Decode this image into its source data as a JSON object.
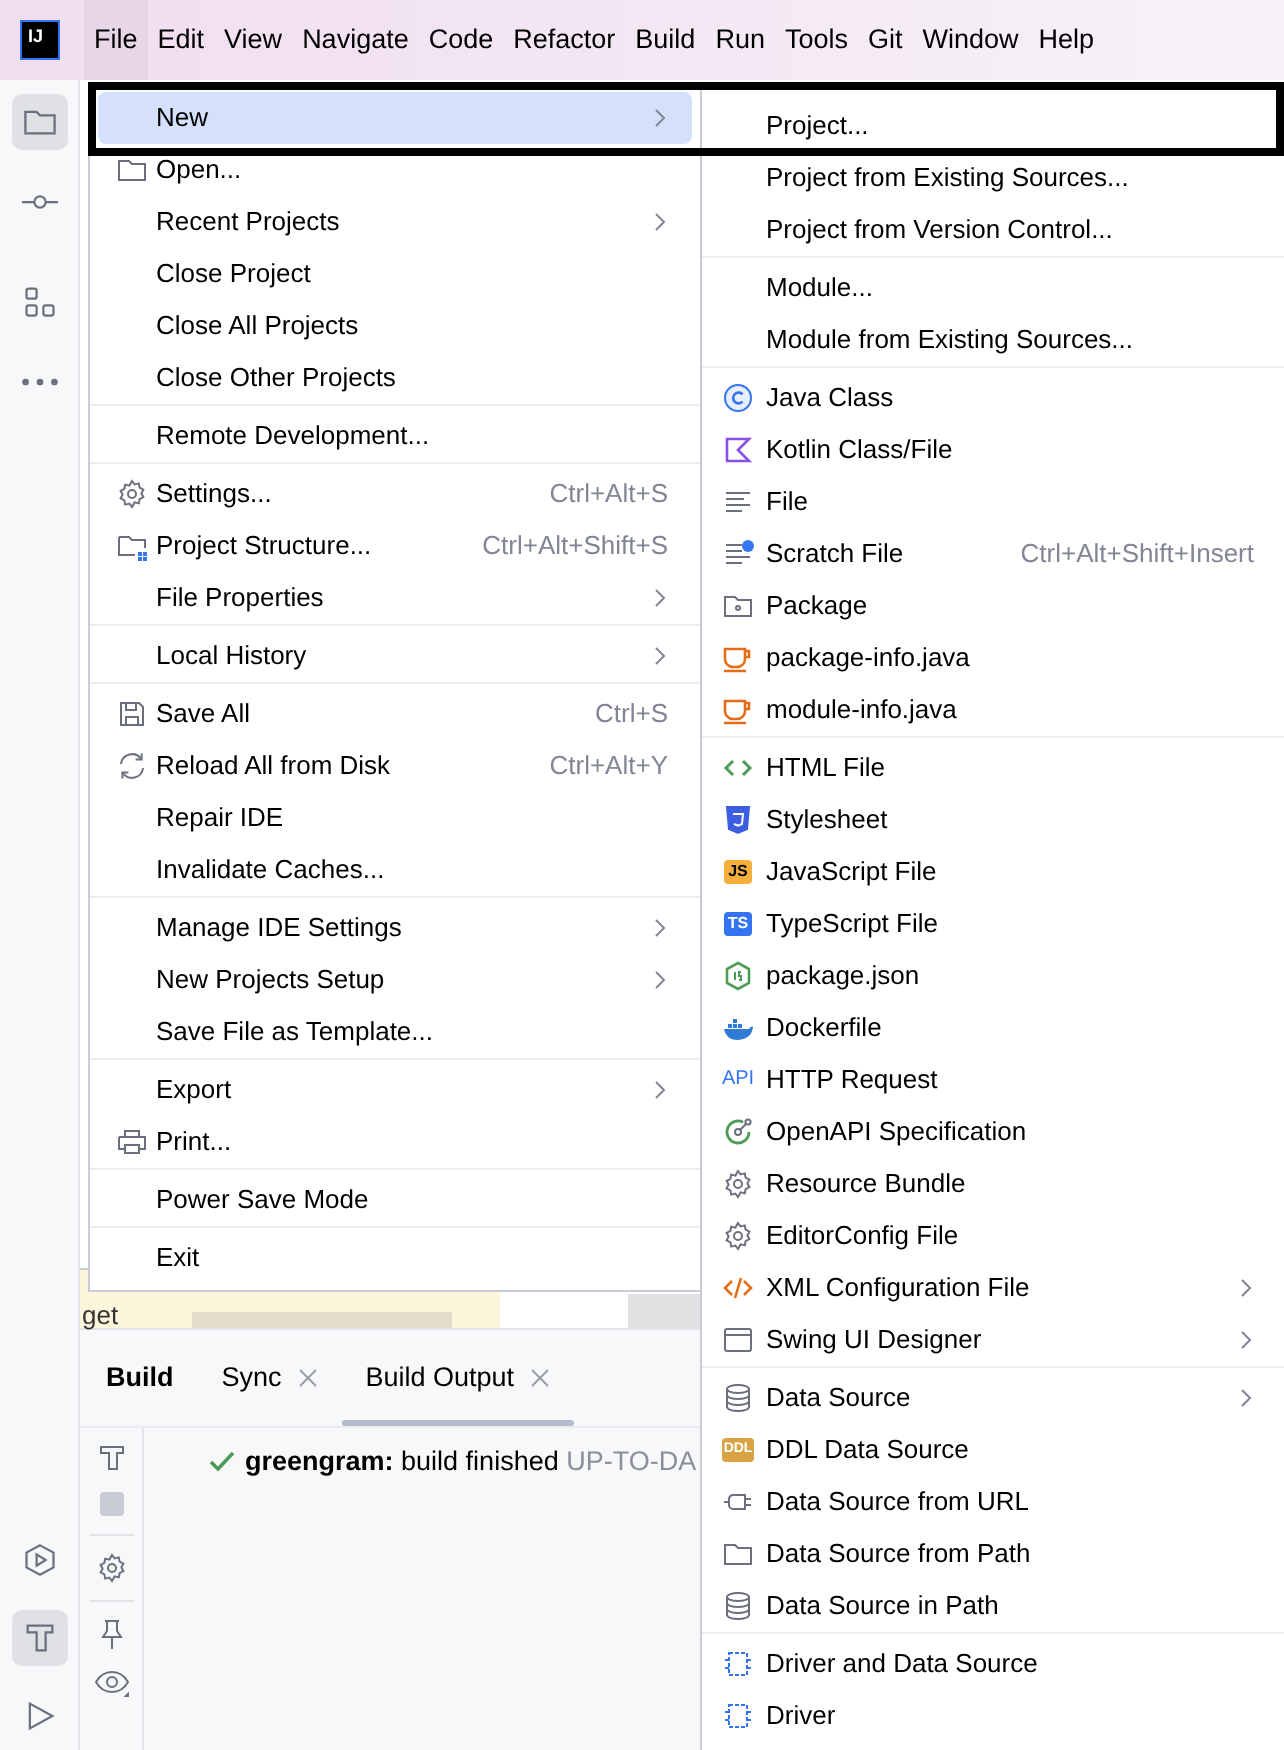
{
  "menubar": {
    "logo": "IJ",
    "items": [
      {
        "label": "File",
        "selected": true
      },
      {
        "label": "Edit",
        "selected": false
      },
      {
        "label": "View",
        "selected": false
      },
      {
        "label": "Navigate",
        "selected": false
      },
      {
        "label": "Code",
        "selected": false
      },
      {
        "label": "Refactor",
        "selected": false
      },
      {
        "label": "Build",
        "selected": false
      },
      {
        "label": "Run",
        "selected": false
      },
      {
        "label": "Tools",
        "selected": false
      },
      {
        "label": "Git",
        "selected": false
      },
      {
        "label": "Window",
        "selected": false
      },
      {
        "label": "Help",
        "selected": false
      }
    ]
  },
  "sidebar": {
    "top": [
      {
        "selected": true
      },
      {
        "selected": false
      },
      {
        "selected": false
      },
      {
        "selected": false
      }
    ],
    "bottom": [
      {
        "selected": false
      },
      {
        "selected": true
      },
      {
        "selected": false
      }
    ]
  },
  "editor": {
    "fragment": "get"
  },
  "file_menu": {
    "groups": [
      [
        {
          "label": "New",
          "submenu": true,
          "selected": true
        },
        {
          "label": "Open...",
          "submenu": false,
          "selected": false
        },
        {
          "label": "Recent Projects",
          "submenu": true,
          "selected": false
        },
        {
          "label": "Close Project",
          "submenu": false,
          "selected": false
        },
        {
          "label": "Close All Projects",
          "submenu": false,
          "selected": false
        },
        {
          "label": "Close Other Projects",
          "submenu": false,
          "selected": false
        }
      ],
      [
        {
          "label": "Remote Development...",
          "submenu": false,
          "selected": false
        }
      ],
      [
        {
          "label": "Settings...",
          "shortcut": "Ctrl+Alt+S",
          "submenu": false,
          "selected": false
        },
        {
          "label": "Project Structure...",
          "shortcut": "Ctrl+Alt+Shift+S",
          "submenu": false,
          "selected": false
        },
        {
          "label": "File Properties",
          "submenu": true,
          "selected": false
        }
      ],
      [
        {
          "label": "Local History",
          "submenu": true,
          "selected": false
        }
      ],
      [
        {
          "label": "Save All",
          "shortcut": "Ctrl+S",
          "submenu": false,
          "selected": false
        },
        {
          "label": "Reload All from Disk",
          "shortcut": "Ctrl+Alt+Y",
          "submenu": false,
          "selected": false
        },
        {
          "label": "Repair IDE",
          "submenu": false,
          "selected": false
        },
        {
          "label": "Invalidate Caches...",
          "submenu": false,
          "selected": false
        }
      ],
      [
        {
          "label": "Manage IDE Settings",
          "submenu": true,
          "selected": false
        },
        {
          "label": "New Projects Setup",
          "submenu": true,
          "selected": false
        },
        {
          "label": "Save File as Template...",
          "submenu": false,
          "selected": false
        }
      ],
      [
        {
          "label": "Export",
          "submenu": true,
          "selected": false
        },
        {
          "label": "Print...",
          "submenu": false,
          "selected": false
        }
      ],
      [
        {
          "label": "Power Save Mode",
          "submenu": false,
          "selected": false
        }
      ],
      [
        {
          "label": "Exit",
          "submenu": false,
          "selected": false
        }
      ]
    ]
  },
  "new_submenu": {
    "groups": [
      [
        {
          "label": "Project...",
          "submenu": false
        },
        {
          "label": "Project from Existing Sources...",
          "submenu": false
        },
        {
          "label": "Project from Version Control...",
          "submenu": false
        }
      ],
      [
        {
          "label": "Module...",
          "submenu": false
        },
        {
          "label": "Module from Existing Sources...",
          "submenu": false
        }
      ],
      [
        {
          "label": "Java Class",
          "submenu": false
        },
        {
          "label": "Kotlin Class/File",
          "submenu": false
        },
        {
          "label": "File",
          "submenu": false
        },
        {
          "label": "Scratch File",
          "shortcut": "Ctrl+Alt+Shift+Insert",
          "submenu": false
        },
        {
          "label": "Package",
          "submenu": false
        },
        {
          "label": "package-info.java",
          "submenu": false
        },
        {
          "label": "module-info.java",
          "submenu": false
        }
      ],
      [
        {
          "label": "HTML File",
          "submenu": false
        },
        {
          "label": "Stylesheet",
          "submenu": false
        },
        {
          "label": "JavaScript File",
          "badge": "JS",
          "submenu": false
        },
        {
          "label": "TypeScript File",
          "badge": "TS",
          "submenu": false
        },
        {
          "label": "package.json",
          "submenu": false
        },
        {
          "label": "Dockerfile",
          "submenu": false
        },
        {
          "label": "HTTP Request",
          "badge": "API",
          "submenu": false
        },
        {
          "label": "OpenAPI Specification",
          "submenu": false
        },
        {
          "label": "Resource Bundle",
          "submenu": false
        },
        {
          "label": "EditorConfig File",
          "submenu": false
        },
        {
          "label": "XML Configuration File",
          "submenu": true
        },
        {
          "label": "Swing UI Designer",
          "submenu": true
        }
      ],
      [
        {
          "label": "Data Source",
          "submenu": true
        },
        {
          "label": "DDL Data Source",
          "badge": "DDL",
          "submenu": false
        },
        {
          "label": "Data Source from URL",
          "submenu": false
        },
        {
          "label": "Data Source from Path",
          "submenu": false
        },
        {
          "label": "Data Source in Path",
          "submenu": false
        }
      ],
      [
        {
          "label": "Driver and Data Source",
          "submenu": false
        },
        {
          "label": "Driver",
          "submenu": false
        }
      ]
    ]
  },
  "build_panel": {
    "title": "Build",
    "tabs": [
      {
        "label": "Sync",
        "closable": true,
        "selected": false
      },
      {
        "label": "Build Output",
        "closable": true,
        "selected": true
      }
    ],
    "output": {
      "project": "greengram:",
      "message": "build finished",
      "status": "UP-TO-DA"
    }
  }
}
